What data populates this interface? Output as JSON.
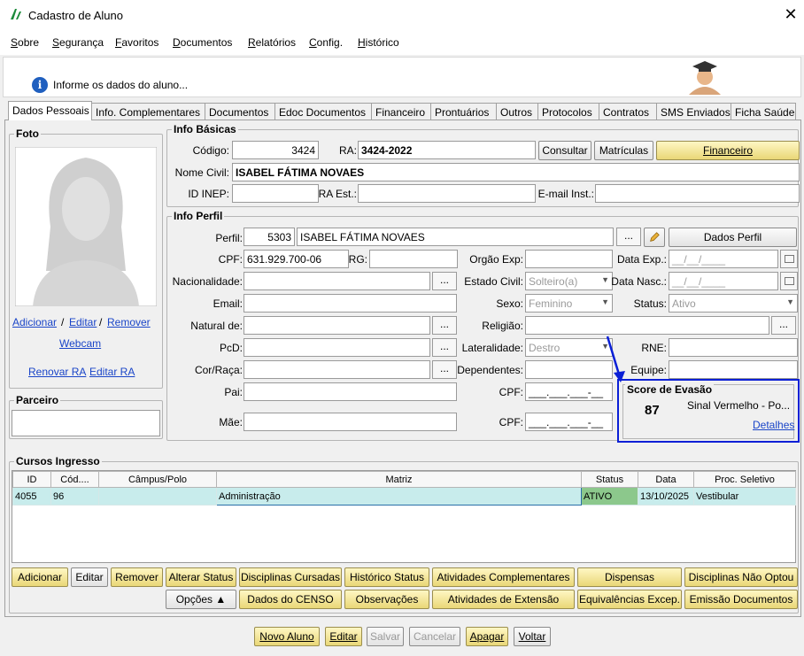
{
  "window": {
    "title": "Cadastro de Aluno",
    "close_glyph": "✕"
  },
  "menu": [
    "Sobre",
    "Segurança",
    "Favoritos",
    "Documentos",
    "Relatórios",
    "Config.",
    "Histórico"
  ],
  "info_message": "Informe os dados do aluno...",
  "tabs": [
    "Dados Pessoais",
    "Info. Complementares",
    "Documentos",
    "Edoc Documentos",
    "Financeiro",
    "Prontuários",
    "Outros",
    "Protocolos",
    "Contratos",
    "SMS Enviados",
    "Ficha Saúde"
  ],
  "foto": {
    "title": "Foto",
    "links": {
      "adicionar": "Adicionar",
      "editar": "Editar",
      "remover": "Remover",
      "sep": "/",
      "webcam": "Webcam",
      "renovar_ra": "Renovar RA",
      "editar_ra": "Editar RA"
    }
  },
  "parceiro": {
    "title": "Parceiro"
  },
  "info_basicas": {
    "title": "Info Básicas",
    "codigo_label": "Código:",
    "codigo": "3424",
    "ra_label": "RA:",
    "ra": "3424-2022",
    "consultar": "Consultar",
    "matriculas": "Matrículas",
    "financeiro": "Financeiro",
    "nome_label": "Nome Civil:",
    "nome": "ISABEL FÁTIMA NOVAES",
    "inep_label": "ID INEP:",
    "ra_est_label": "RA Est.:",
    "email_inst_label": "E-mail Inst.:"
  },
  "info_perfil": {
    "title": "Info Perfil",
    "perfil_label": "Perfil:",
    "perfil_id": "5303",
    "perfil_nome": "ISABEL FÁTIMA NOVAES",
    "dots": "...",
    "dados_perfil": "Dados Perfil",
    "cpf_label": "CPF:",
    "cpf": "631.929.700-06",
    "rg_label": "RG:",
    "orgao_label": "Orgão Exp:",
    "data_exp_label": "Data Exp.:",
    "date_mask": "__/__/____",
    "nacionalidade_label": "Nacionalidade:",
    "estado_civil_label": "Estado Civil:",
    "estado_civil": "Solteiro(a)",
    "data_nasc_label": "Data Nasc.:",
    "email_label": "Email:",
    "sexo_label": "Sexo:",
    "sexo": "Feminino",
    "status_label": "Status:",
    "status": "Ativo",
    "natural_label": "Natural de:",
    "religiao_label": "Religião:",
    "pcd_label": "PcD:",
    "lateralidade_label": "Lateralidade:",
    "lateralidade": "Destro",
    "rne_label": "RNE:",
    "cor_label": "Cor/Raça:",
    "dependentes_label": "Dependentes:",
    "equipe_label": "Equipe:",
    "pai_label": "Pai:",
    "mae_label": "Mãe:",
    "cpf_mask": "___.___.___-__",
    "score": {
      "title": "Score de Evasão",
      "value": "87",
      "signal": "Sinal Vermelho -  Po...",
      "detalhes": "Detalhes"
    }
  },
  "cursos": {
    "title": "Cursos Ingresso",
    "columns": [
      "ID",
      "Cód....",
      "Câmpus/Polo",
      "Matriz",
      "Status",
      "Data",
      "Proc. Seletivo"
    ],
    "rows": [
      {
        "id": "4055",
        "cod": "96",
        "campus": "",
        "matriz": "Administração",
        "status": "ATIVO",
        "data": "13/10/2025",
        "proc": "Vestibular"
      }
    ]
  },
  "actions_row1": [
    "Adicionar",
    "Editar",
    "Remover",
    "Alterar Status",
    "Disciplinas Cursadas",
    "Histórico Status",
    "Atividades Complementares",
    "Dispensas",
    "Disciplinas Não Optou"
  ],
  "actions_row2": [
    "Opções ▲",
    "Dados do CENSO",
    "Observações",
    "Atividades de Extensão",
    "Equivalências Excep.",
    "Emissão Documentos"
  ],
  "bottom": [
    "Novo Aluno",
    "Editar",
    "Salvar",
    "Cancelar",
    "Apagar",
    "Voltar"
  ],
  "colors": {
    "accent_blue": "#0a1fd6",
    "status_green": "#8cc88c",
    "row_highlight": "#c8ecec",
    "yellow_button": "#f3e6a0"
  }
}
